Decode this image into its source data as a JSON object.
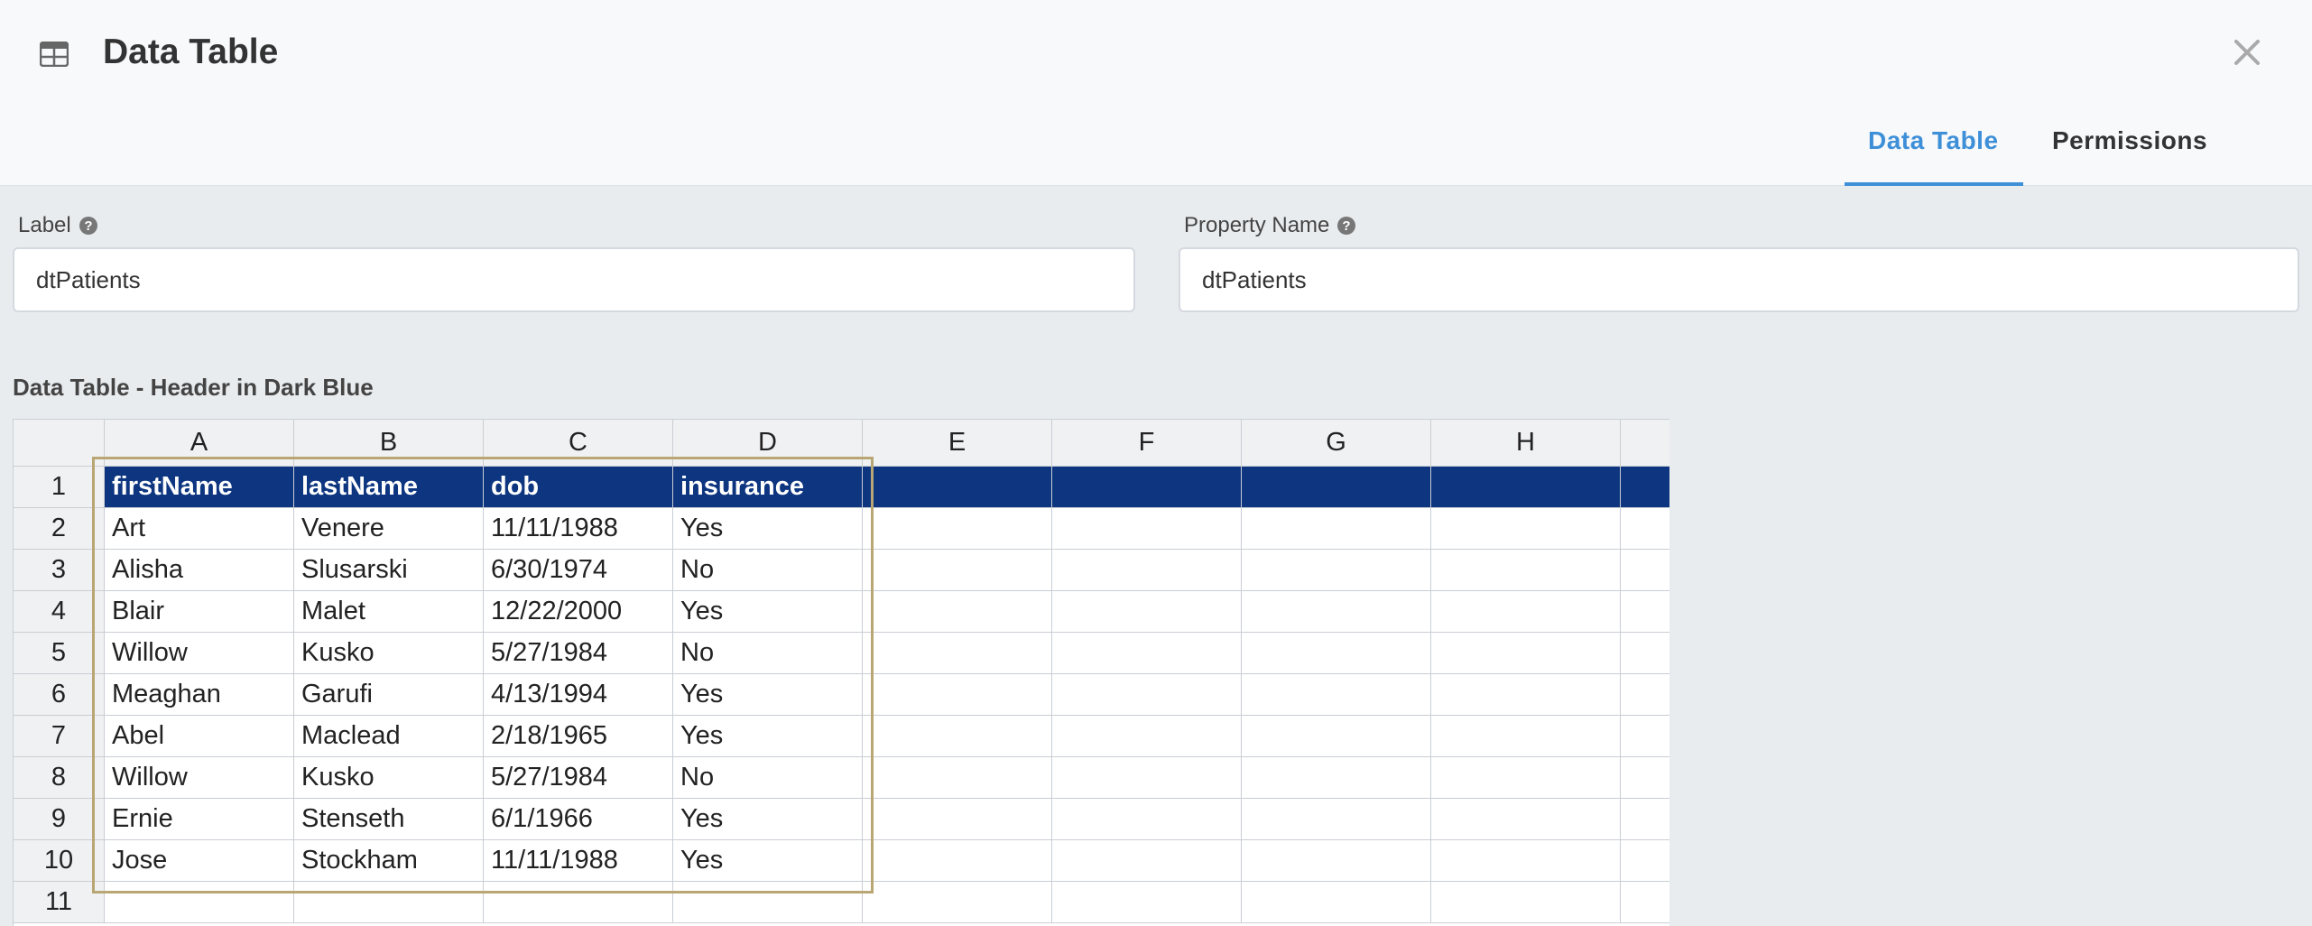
{
  "dialog": {
    "title": "Data Table",
    "icon": "table-icon",
    "close_icon": "close-icon"
  },
  "tabs": [
    {
      "label": "Data Table",
      "active": true
    },
    {
      "label": "Permissions",
      "active": false
    }
  ],
  "fields": {
    "label": {
      "label": "Label",
      "value": "dtPatients"
    },
    "property_name": {
      "label": "Property Name",
      "value": "dtPatients"
    }
  },
  "section_label": "Data Table - Header in Dark Blue",
  "colors": {
    "accent": "#3d8fd8",
    "header_dark_blue": "#0d3580",
    "selection_border": "#b8a774"
  },
  "sheet": {
    "columns": [
      "A",
      "B",
      "C",
      "D",
      "E",
      "F",
      "G",
      "H"
    ],
    "row_numbers": [
      "1",
      "2",
      "3",
      "4",
      "5",
      "6",
      "7",
      "8",
      "9",
      "10",
      "11"
    ],
    "rows": [
      [
        "firstName",
        "lastName",
        "dob",
        "insurance"
      ],
      [
        "Art",
        "Venere",
        "11/11/1988",
        "Yes"
      ],
      [
        "Alisha",
        "Slusarski",
        "6/30/1974",
        "No"
      ],
      [
        "Blair",
        "Malet",
        "12/22/2000",
        "Yes"
      ],
      [
        "Willow",
        "Kusko",
        "5/27/1984",
        "No"
      ],
      [
        "Meaghan",
        "Garufi",
        "4/13/1994",
        "Yes"
      ],
      [
        "Abel",
        "Maclead",
        "2/18/1965",
        "Yes"
      ],
      [
        "Willow",
        "Kusko",
        "5/27/1984",
        "No"
      ],
      [
        "Ernie",
        "Stenseth",
        "6/1/1966",
        "Yes"
      ],
      [
        "Jose",
        "Stockham",
        "11/11/1988",
        "Yes"
      ],
      [
        "",
        "",
        "",
        ""
      ]
    ]
  }
}
